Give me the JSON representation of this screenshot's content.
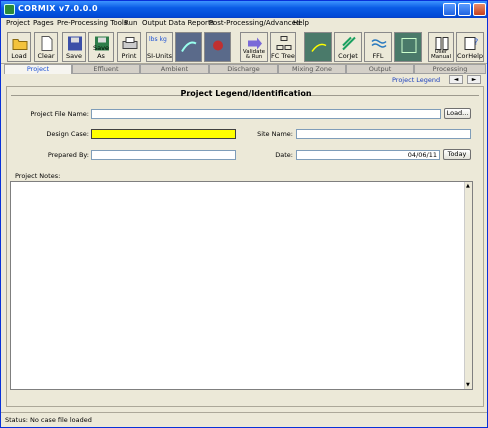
{
  "window": {
    "title": "CORMIX v7.0.0.0"
  },
  "menu": [
    "Project",
    "Pages",
    "Pre-Processing Tools",
    "Run",
    "Output Data Reports",
    "Post-Processing/Advanced",
    "Help"
  ],
  "toolbar": {
    "load": "Load",
    "clear": "Clear",
    "save": "Save",
    "save_as": "Save As",
    "print": "Print",
    "si_units": "SI-Units",
    "si_units_top": "lbs kg",
    "validate_run": "Validate & Run",
    "fc_tree": "FC Tree",
    "corjet": "CorJet",
    "ffl": "FFL",
    "user_manual": "User Manual",
    "corhelp": "CorHelp"
  },
  "tabs": [
    "Project",
    "Effluent",
    "Ambient",
    "Discharge",
    "Mixing Zone",
    "Output",
    "Processing"
  ],
  "sub": {
    "project_legend": "Project Legend",
    "back": "◄",
    "fwd": "►"
  },
  "form": {
    "heading": "Project Legend/Identification",
    "project_file_label": "Project File Name:",
    "project_file_value": "",
    "load_button": "Load...",
    "design_case_label": "Design Case:",
    "design_case_value": "",
    "site_name_label": "Site Name:",
    "site_name_value": "",
    "prepared_by_label": "Prepared By:",
    "prepared_by_value": "",
    "date_label": "Date:",
    "date_value": "04/06/11",
    "today_button": "Today",
    "notes_label": "Project Notes:",
    "notes_value": ""
  },
  "status": {
    "text": "Status: No case file loaded"
  },
  "colors": {
    "accent": "#0a5ce6",
    "highlight": "#ffff00",
    "active_tab": "#1a4fd6"
  }
}
